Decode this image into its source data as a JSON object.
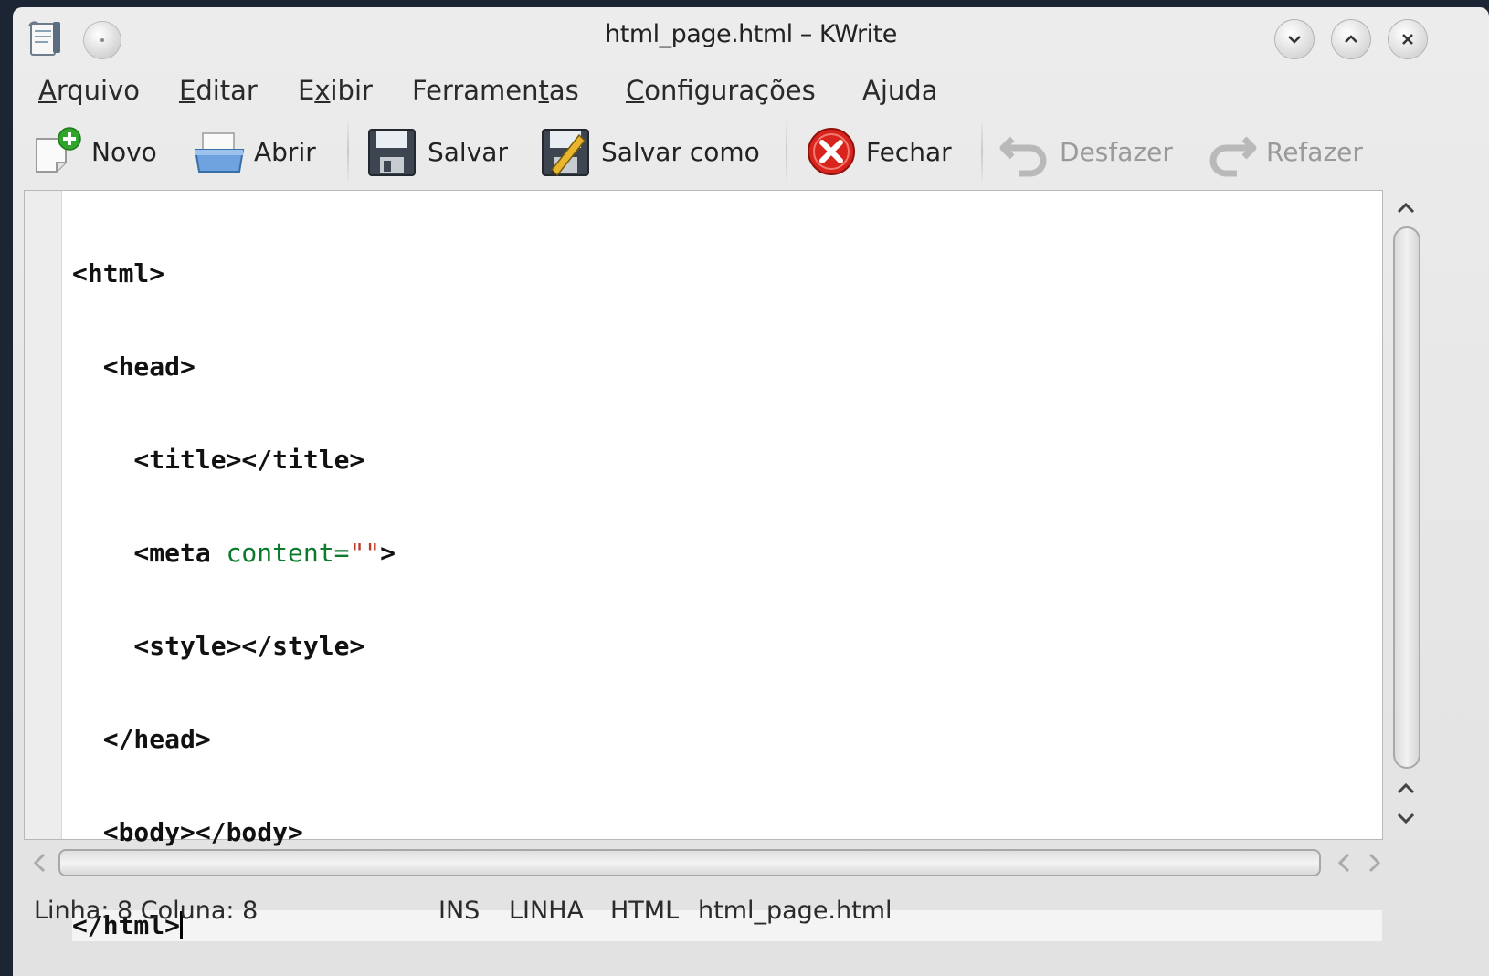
{
  "window": {
    "title": "html_page.html – KWrite"
  },
  "menu": {
    "items": [
      {
        "pre": "",
        "acc": "A",
        "post": "rquivo"
      },
      {
        "pre": "",
        "acc": "E",
        "post": "ditar"
      },
      {
        "pre": "E",
        "acc": "x",
        "post": "ibir"
      },
      {
        "pre": "Ferramen",
        "acc": "t",
        "post": "as"
      },
      {
        "pre": "",
        "acc": "C",
        "post": "onfigurações"
      },
      {
        "pre": "A",
        "acc": "j",
        "post": "uda"
      }
    ]
  },
  "toolbar": {
    "novo": "Novo",
    "abrir": "Abrir",
    "salvar": "Salvar",
    "salvar_como": "Salvar como",
    "fechar": "Fechar",
    "desfazer": "Desfazer",
    "refazer": "Refazer"
  },
  "editor": {
    "lines": [
      {
        "text": "<html>"
      },
      {
        "text": "  <head>"
      },
      {
        "text": "    <title></title>"
      },
      {
        "pre": "    <meta ",
        "attr": "content=",
        "str": "\"\"",
        "post": ">"
      },
      {
        "text": "    <style></style>"
      },
      {
        "text": "  </head>"
      },
      {
        "text": "  <body></body>"
      },
      {
        "text": "</html>"
      }
    ]
  },
  "status": {
    "position": "Linha: 8 Coluna: 8",
    "mode": "INS",
    "selection_mode": "LINHA",
    "syntax": "HTML",
    "filename": "html_page.html"
  }
}
